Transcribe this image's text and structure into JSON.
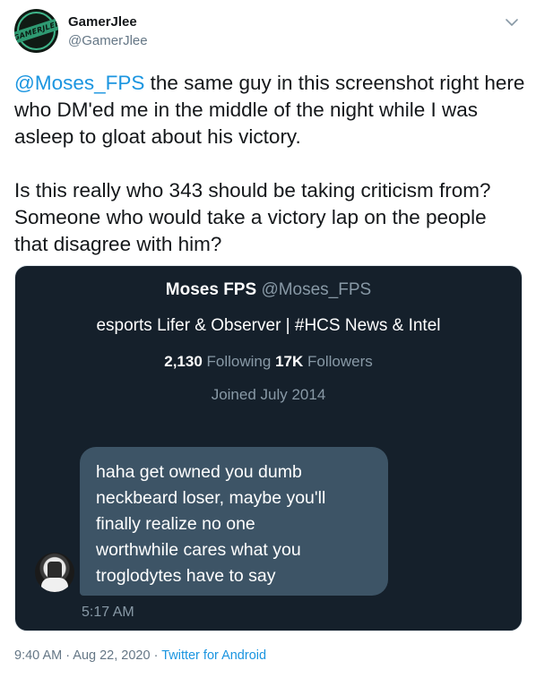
{
  "author": {
    "name": "GamerJlee",
    "handle": "@GamerJlee",
    "avatar_text": "GAMERJLEE"
  },
  "tweet": {
    "para1_mention": "@Moses_FPS",
    "para1_text": " the same guy in this screenshot right here who DM'ed me in the middle of the night while I was asleep to gloat about his victory.",
    "para2_text": "Is this really who 343 should be taking criticism from? Someone who would take a victory lap on the people that disagree with him?"
  },
  "screenshot": {
    "profile_name": "Moses FPS",
    "profile_handle": "@Moses_FPS",
    "bio": "esports Lifer & Observer | #HCS News & Intel",
    "following_count": "2,130",
    "following_label": "Following",
    "followers_count": "17K",
    "followers_label": "Followers",
    "joined": "Joined July 2014",
    "dm_text": "haha get owned you dumb\nneckbeard loser, maybe you'll\nfinally realize no one\nworthwhile cares what you\ntroglodytes have to say",
    "dm_time": "5:17 AM"
  },
  "footer": {
    "timestamp": "9:40 AM · Aug 22, 2020",
    "separator": " · ",
    "source": "Twitter for Android"
  },
  "colors": {
    "link": "#1b95e0",
    "muted": "#657786",
    "dark_bg": "#15202b",
    "bubble": "#3d5466"
  },
  "icons": {
    "caret": "chevron-down-icon"
  }
}
